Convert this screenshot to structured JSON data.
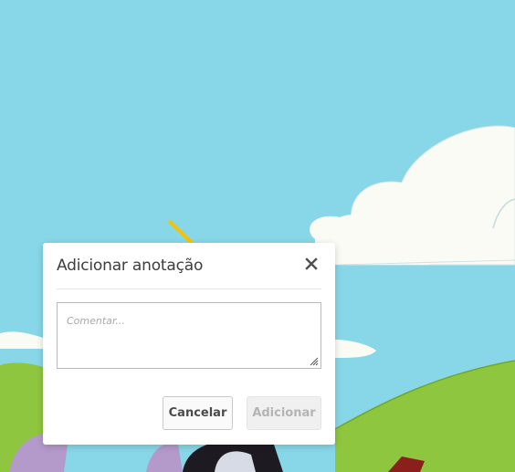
{
  "dialog": {
    "title": "Adicionar anotação",
    "close_icon": "close-icon",
    "comment_placeholder": "Comentar...",
    "comment_value": "",
    "cancel_label": "Cancelar",
    "add_label": "Adicionar",
    "add_enabled": false
  },
  "colors": {
    "sky": "#87d7e8",
    "grass": "#8fc63f",
    "cloud": "#fbfbf5",
    "dialog_bg": "#ffffff",
    "disabled_text": "#b4b4b4"
  }
}
